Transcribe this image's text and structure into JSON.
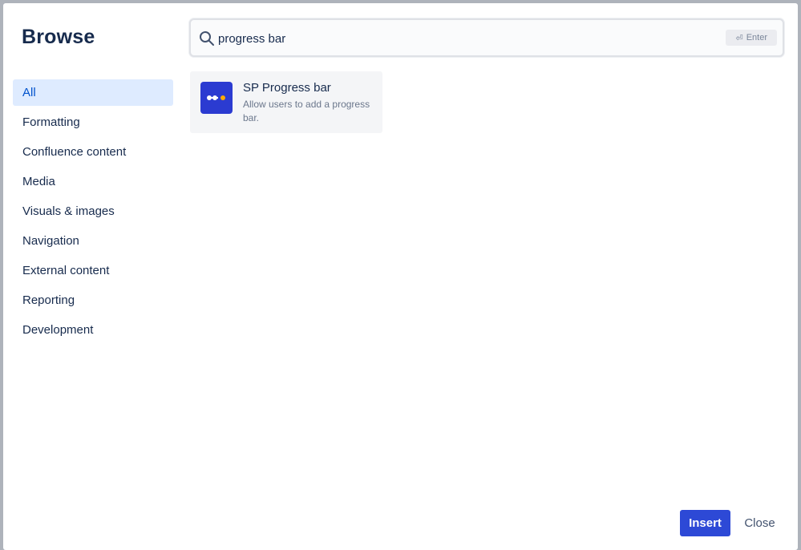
{
  "dialog": {
    "title": "Browse"
  },
  "categories": [
    {
      "label": "All",
      "active": true
    },
    {
      "label": "Formatting",
      "active": false
    },
    {
      "label": "Confluence content",
      "active": false
    },
    {
      "label": "Media",
      "active": false
    },
    {
      "label": "Visuals & images",
      "active": false
    },
    {
      "label": "Navigation",
      "active": false
    },
    {
      "label": "External content",
      "active": false
    },
    {
      "label": "Reporting",
      "active": false
    },
    {
      "label": "Development",
      "active": false
    }
  ],
  "search": {
    "value": "progress bar",
    "placeholder": "",
    "enter_hint": "Enter",
    "icon": "search-icon"
  },
  "results": [
    {
      "name": "SP Progress bar",
      "description": "Allow users to add a progress bar.",
      "icon": "progress-bar-icon"
    }
  ],
  "footer": {
    "insert_label": "Insert",
    "close_label": "Close"
  },
  "colors": {
    "accent": "#0052cc",
    "primary_button": "#2d49d6",
    "active_bg": "#deebff",
    "card_bg": "#f4f5f7",
    "icon_bg": "#2b3bd1",
    "icon_dot": "#ffab00"
  }
}
